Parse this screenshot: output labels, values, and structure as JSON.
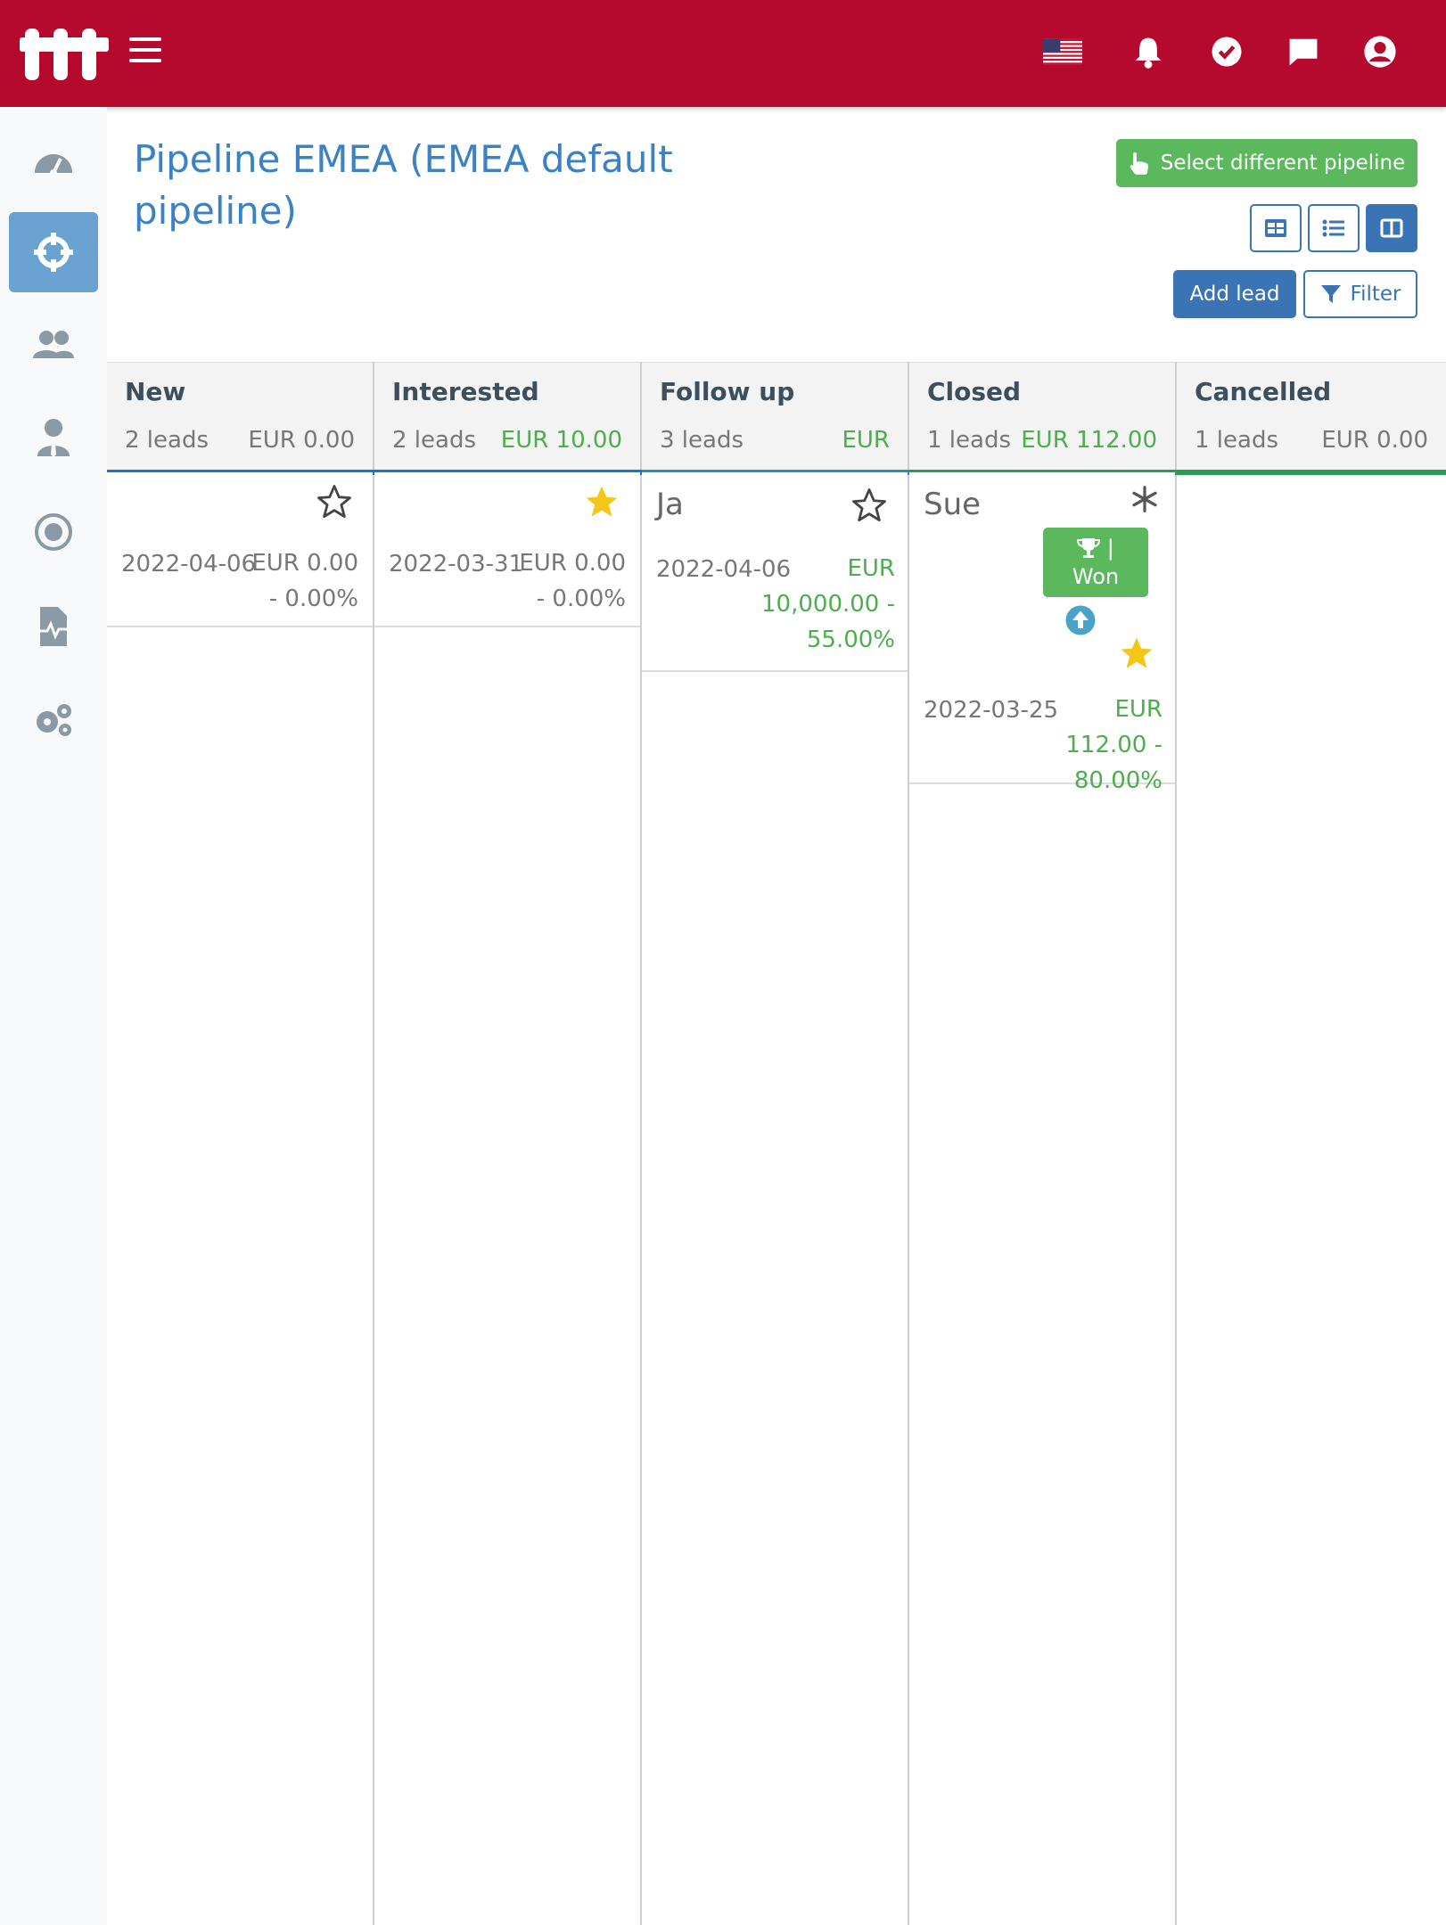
{
  "header": {
    "icons": [
      "app-logo",
      "hamburger-menu-icon",
      "us-flag-icon",
      "bell-icon",
      "check-circle-icon",
      "chat-icon",
      "user-circle-icon"
    ],
    "brand_color": "#b5092e"
  },
  "sidebar": {
    "items": [
      {
        "icon": "gauge-icon",
        "active": false
      },
      {
        "icon": "crosshair-icon",
        "active": true
      },
      {
        "icon": "users-icon",
        "active": false
      },
      {
        "icon": "user-tie-icon",
        "active": false
      },
      {
        "icon": "target-icon",
        "active": false
      },
      {
        "icon": "file-chart-icon",
        "active": false
      },
      {
        "icon": "gears-icon",
        "active": false
      }
    ]
  },
  "page": {
    "title": "Pipeline EMEA (EMEA default pipeline)",
    "select_pipeline_label": "Select different pipeline",
    "add_lead_label": "Add lead",
    "filter_label": "Filter",
    "view_modes": [
      "table-view-icon",
      "list-view-icon",
      "kanban-view-icon"
    ],
    "active_view": "kanban"
  },
  "columns": [
    {
      "name": "New",
      "count": "2 leads",
      "amount": "EUR 0.00",
      "amount_green": false,
      "bar_color": "#1a73d9",
      "cards": [
        {
          "name": "",
          "star": "empty",
          "date": "2022-04-06",
          "amount": "EUR 0.00 - 0.00%",
          "green": false
        }
      ]
    },
    {
      "name": "Interested",
      "count": "2 leads",
      "amount": "EUR 10.00",
      "amount_green": true,
      "bar_color": "#1a73d9",
      "cards": [
        {
          "name": "",
          "star": "filled",
          "date": "2022-03-31",
          "amount": "EUR 0.00 - 0.00%",
          "green": false
        }
      ]
    },
    {
      "name": "Follow up",
      "count": "3 leads",
      "amount": "EUR",
      "amount_green": true,
      "bar_color": "#2a8fbf",
      "cards": [
        {
          "name": "Ja",
          "star": "empty",
          "date": "2022-04-06",
          "amount": "EUR 10,000.00 - 55.00%",
          "green": true
        }
      ]
    },
    {
      "name": "Closed",
      "count": "1 leads",
      "amount": "EUR 112.00",
      "amount_green": true,
      "bar_color": "#2e9a5a",
      "cards": [
        {
          "name": "Sue",
          "star": "filled",
          "date": "2022-03-25",
          "amount": "EUR 112.00 - 80.00%",
          "green": true,
          "won_label": "Won"
        }
      ]
    },
    {
      "name": "Cancelled",
      "count": "1 leads",
      "amount": "EUR 0.00",
      "amount_green": false,
      "bar_color": "#2e9a5a",
      "cards": []
    }
  ]
}
